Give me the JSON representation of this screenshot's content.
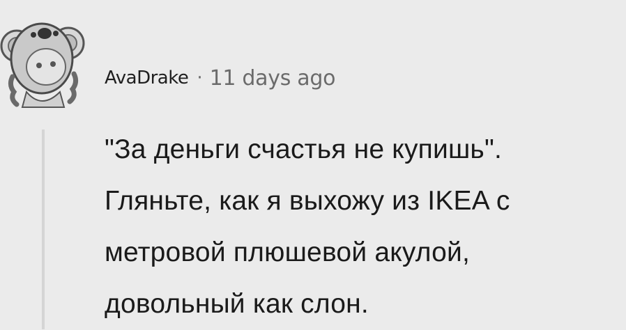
{
  "comment": {
    "author": "AvaDrake",
    "separator": "·",
    "timestamp": "11 days ago",
    "avatar_icon": "koala-icon",
    "body_lines": [
      "\"За деньги счастья не купишь\".",
      "Гляньте, как я выхожу из IKEA с",
      "метровой плюшевой акулой,",
      "довольный как слон."
    ]
  },
  "colors": {
    "background": "#ebebeb",
    "text": "#1a1a1a",
    "meta": "#6b6b6b",
    "thread_line": "#d5d5d5"
  }
}
